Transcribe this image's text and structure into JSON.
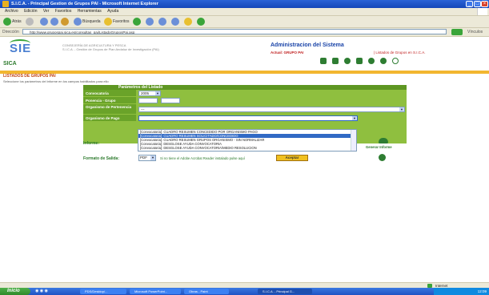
{
  "window": {
    "title": "S.I.C.A. - Principal Gestion de Grupos PAI - Microsoft Internet Explorer"
  },
  "menu": [
    "Archivo",
    "Edición",
    "Ver",
    "Favoritos",
    "Herramientas",
    "Ayuda"
  ],
  "toolbar": {
    "back": "Atrás",
    "search": "Búsqueda",
    "favorites": "Favoritos"
  },
  "address": {
    "label": "Dirección",
    "url": "http://www.grupospai.sica.es/consultas_pai/ListadoGruposPai.asp",
    "go": "Ir",
    "links": "Vínculos"
  },
  "header": {
    "logo": "SIE",
    "sica": "SICA",
    "subtitle_1": "CONSEJERÍA DE AGRICULTURA Y PESCA",
    "subtitle_2": "S.I.C.A. - Gestión de Grupos de Plan Andaluz de Investigación (PAI)",
    "admin_title": "Administracion del Sistema",
    "admin_user": "Actual: GRUPO PAI",
    "admin_link": "| Listados de Grupos en S.I.C.A."
  },
  "page": {
    "list_title": "LISTADOS DE GRUPOS PAI",
    "instructions": "Seleccione los parámetros del informe en los campos habilitados para ello"
  },
  "form": {
    "header": "Parámetros del Listado",
    "rows": [
      {
        "label": "Convocatoria",
        "value": "2005"
      },
      {
        "label": "Ponencia - Grupo",
        "value": ""
      },
      {
        "label": "Organismo de Pertenencia",
        "value": "---"
      },
      {
        "label": "Organismo de Pago",
        "value": ""
      }
    ]
  },
  "informe": {
    "label": "Informe:",
    "options": [
      "[Convocatoria]: CUADRO RESUMEN CONCEDIDO POR ORGANISMO PAGO",
      "[Convocatoria]: CUADRO RESUMEN SOLICITADO/CONCEDIDO",
      "[Convocatoria]: CUADRO RESUMEN GRUPOS ORGANISMO - SIN NORMALIZAR",
      "[Convocatoria]: DESGLOSE AYUDA CONVOCATORIA",
      "[Convocatoria]: DESGLOSE AYUDA CONVOCATORIA/MEDIO RESOLUCION"
    ],
    "selected_index": 1,
    "generate_label": "Generar Informe"
  },
  "salida": {
    "label": "Formato de Salida:",
    "value": "PDF",
    "hint": "Si no tiene el Adobe Acrobat Reader instalado pulse aquí",
    "accept": "Aceptar"
  },
  "status": {
    "zone": "Internet"
  },
  "taskbar": {
    "start": "Inicio",
    "tasks": [
      "PDS/Desktop/...",
      "Microsoft PowerPoint...",
      "Obras - Paint",
      "S.I.C.A. - Principal G..."
    ],
    "tray": "12:09"
  }
}
